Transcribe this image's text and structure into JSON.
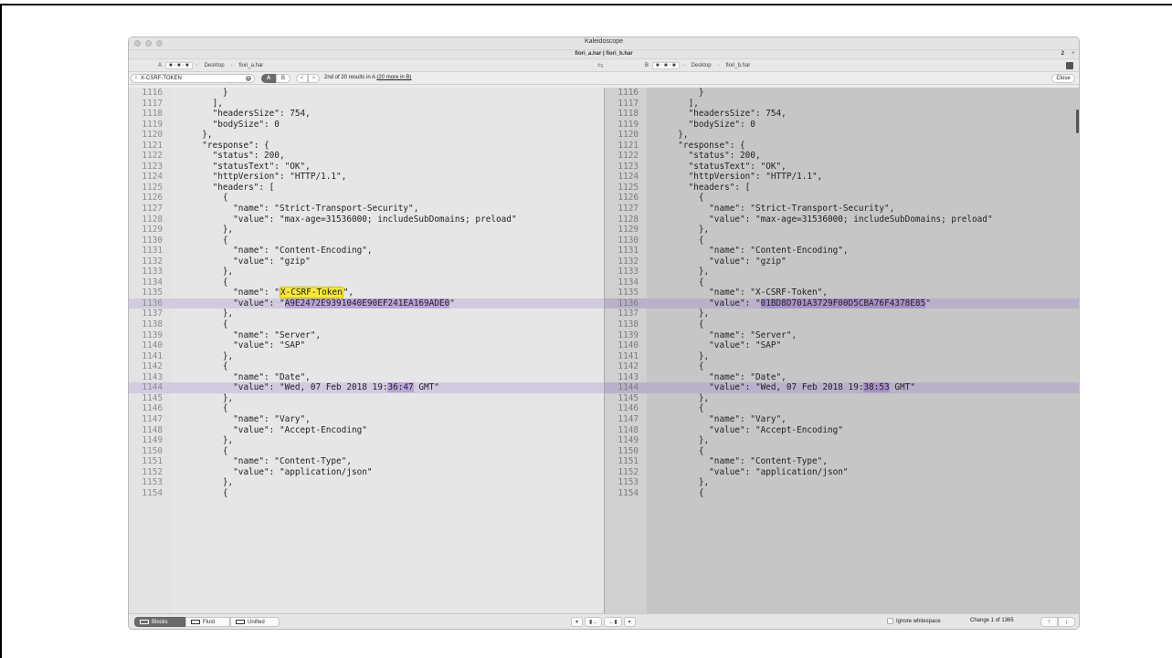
{
  "window": {
    "title": "Kaleidoscope",
    "tab_title": "fiori_a.har | fiori_b.har",
    "tab_count": "2",
    "tab_add": "+"
  },
  "paths": {
    "a": {
      "side_label": "A",
      "folder": "Desktop",
      "file": "fiori_a.har"
    },
    "b": {
      "side_label": "B",
      "folder": "Desktop",
      "file": "fiori_b.har"
    },
    "swap_glyph": "⇆"
  },
  "search": {
    "query": "X-CSRF-TOKEN",
    "seg_a": "A",
    "seg_b": "B",
    "prev": "<",
    "next": ">",
    "results_text": "2nd of 20 results in A",
    "more_text": "(20 more in B)",
    "close_label": "Close"
  },
  "pane_a_lines": [
    {
      "n": "1116",
      "t": "      }",
      "hl": false
    },
    {
      "n": "1117",
      "t": "    ],",
      "hl": false
    },
    {
      "n": "1118",
      "t": "    \"headersSize\": 754,",
      "hl": false
    },
    {
      "n": "1119",
      "t": "    \"bodySize\": 0",
      "hl": false
    },
    {
      "n": "1120",
      "t": "  },",
      "hl": false
    },
    {
      "n": "1121",
      "t": "  \"response\": {",
      "hl": false
    },
    {
      "n": "1122",
      "t": "    \"status\": 200,",
      "hl": false
    },
    {
      "n": "1123",
      "t": "    \"statusText\": \"OK\",",
      "hl": false
    },
    {
      "n": "1124",
      "t": "    \"httpVersion\": \"HTTP/1.1\",",
      "hl": false
    },
    {
      "n": "1125",
      "t": "    \"headers\": [",
      "hl": false
    },
    {
      "n": "1126",
      "t": "      {",
      "hl": false
    },
    {
      "n": "1127",
      "t": "        \"name\": \"Strict-Transport-Security\",",
      "hl": false
    },
    {
      "n": "1128",
      "t": "        \"value\": \"max-age=31536000; includeSubDomains; preload\"",
      "hl": false
    },
    {
      "n": "1129",
      "t": "      },",
      "hl": false
    },
    {
      "n": "1130",
      "t": "      {",
      "hl": false
    },
    {
      "n": "1131",
      "t": "        \"name\": \"Content-Encoding\",",
      "hl": false
    },
    {
      "n": "1132",
      "t": "        \"value\": \"gzip\"",
      "hl": false
    },
    {
      "n": "1133",
      "t": "      },",
      "hl": false
    },
    {
      "n": "1134",
      "t": "      {",
      "hl": false
    },
    {
      "n": "1135",
      "pre": "        \"name\": \"",
      "find": "X-CSRF-Token",
      "post": "\",",
      "hl": false
    },
    {
      "n": "1136",
      "pre": "        \"value\": \"",
      "diff": "A9E2472E9391040E90EF241EA169ADE0",
      "post": "\"",
      "hl": true
    },
    {
      "n": "1137",
      "t": "      },",
      "hl": false
    },
    {
      "n": "1138",
      "t": "      {",
      "hl": false
    },
    {
      "n": "1139",
      "t": "        \"name\": \"Server\",",
      "hl": false
    },
    {
      "n": "1140",
      "t": "        \"value\": \"SAP\"",
      "hl": false
    },
    {
      "n": "1141",
      "t": "      },",
      "hl": false
    },
    {
      "n": "1142",
      "t": "      {",
      "hl": false
    },
    {
      "n": "1143",
      "t": "        \"name\": \"Date\",",
      "hl": false
    },
    {
      "n": "1144",
      "pre": "        \"value\": \"Wed, 07 Feb 2018 19:",
      "diff": "36:47",
      "post": " GMT\"",
      "hl": true
    },
    {
      "n": "1145",
      "t": "      },",
      "hl": false
    },
    {
      "n": "1146",
      "t": "      {",
      "hl": false
    },
    {
      "n": "1147",
      "t": "        \"name\": \"Vary\",",
      "hl": false
    },
    {
      "n": "1148",
      "t": "        \"value\": \"Accept-Encoding\"",
      "hl": false
    },
    {
      "n": "1149",
      "t": "      },",
      "hl": false
    },
    {
      "n": "1150",
      "t": "      {",
      "hl": false
    },
    {
      "n": "1151",
      "t": "        \"name\": \"Content-Type\",",
      "hl": false
    },
    {
      "n": "1152",
      "t": "        \"value\": \"application/json\"",
      "hl": false
    },
    {
      "n": "1153",
      "t": "      },",
      "hl": false
    },
    {
      "n": "1154",
      "t": "      {",
      "hl": false
    }
  ],
  "pane_b_lines": [
    {
      "n": "1116",
      "t": "      }",
      "hl": false
    },
    {
      "n": "1117",
      "t": "    ],",
      "hl": false
    },
    {
      "n": "1118",
      "t": "    \"headersSize\": 754,",
      "hl": false
    },
    {
      "n": "1119",
      "t": "    \"bodySize\": 0",
      "hl": false
    },
    {
      "n": "1120",
      "t": "  },",
      "hl": false
    },
    {
      "n": "1121",
      "t": "  \"response\": {",
      "hl": false
    },
    {
      "n": "1122",
      "t": "    \"status\": 200,",
      "hl": false
    },
    {
      "n": "1123",
      "t": "    \"statusText\": \"OK\",",
      "hl": false
    },
    {
      "n": "1124",
      "t": "    \"httpVersion\": \"HTTP/1.1\",",
      "hl": false
    },
    {
      "n": "1125",
      "t": "    \"headers\": [",
      "hl": false
    },
    {
      "n": "1126",
      "t": "      {",
      "hl": false
    },
    {
      "n": "1127",
      "t": "        \"name\": \"Strict-Transport-Security\",",
      "hl": false
    },
    {
      "n": "1128",
      "t": "        \"value\": \"max-age=31536000; includeSubDomains; preload\"",
      "hl": false
    },
    {
      "n": "1129",
      "t": "      },",
      "hl": false
    },
    {
      "n": "1130",
      "t": "      {",
      "hl": false
    },
    {
      "n": "1131",
      "t": "        \"name\": \"Content-Encoding\",",
      "hl": false
    },
    {
      "n": "1132",
      "t": "        \"value\": \"gzip\"",
      "hl": false
    },
    {
      "n": "1133",
      "t": "      },",
      "hl": false
    },
    {
      "n": "1134",
      "t": "      {",
      "hl": false
    },
    {
      "n": "1135",
      "t": "        \"name\": \"X-CSRF-Token\",",
      "hl": false
    },
    {
      "n": "1136",
      "pre": "        \"value\": \"",
      "diff": "01BD8D701A3729F00D5CBA76F4378E85",
      "post": "\"",
      "hl": true
    },
    {
      "n": "1137",
      "t": "      },",
      "hl": false
    },
    {
      "n": "1138",
      "t": "      {",
      "hl": false
    },
    {
      "n": "1139",
      "t": "        \"name\": \"Server\",",
      "hl": false
    },
    {
      "n": "1140",
      "t": "        \"value\": \"SAP\"",
      "hl": false
    },
    {
      "n": "1141",
      "t": "      },",
      "hl": false
    },
    {
      "n": "1142",
      "t": "      {",
      "hl": false
    },
    {
      "n": "1143",
      "t": "        \"name\": \"Date\",",
      "hl": false
    },
    {
      "n": "1144",
      "pre": "        \"value\": \"Wed, 07 Feb 2018 19:",
      "diff": "38:53",
      "post": " GMT\"",
      "hl": true
    },
    {
      "n": "1145",
      "t": "      },",
      "hl": false
    },
    {
      "n": "1146",
      "t": "      {",
      "hl": false
    },
    {
      "n": "1147",
      "t": "        \"name\": \"Vary\",",
      "hl": false
    },
    {
      "n": "1148",
      "t": "        \"value\": \"Accept-Encoding\"",
      "hl": false
    },
    {
      "n": "1149",
      "t": "      },",
      "hl": false
    },
    {
      "n": "1150",
      "t": "      {",
      "hl": false
    },
    {
      "n": "1151",
      "t": "        \"name\": \"Content-Type\",",
      "hl": false
    },
    {
      "n": "1152",
      "t": "        \"value\": \"application/json\"",
      "hl": false
    },
    {
      "n": "1153",
      "t": "      },",
      "hl": false
    },
    {
      "n": "1154",
      "t": "      {",
      "hl": false
    }
  ],
  "bottom": {
    "blocks_label": "Blocks",
    "fluid_label": "Fluid",
    "unified_label": "Unified",
    "mid_down": "▾",
    "mid_copy_right": "▮→",
    "mid_copy_left": "←▮",
    "mid_down2": "▾",
    "ignore_label": "Ignore whitespace",
    "change_text": "Change 1 of 1365",
    "up_arrow": "↑",
    "down_arrow": "↓"
  },
  "colors": {
    "find_highlight": "#f5e83a",
    "diff_highlight": "#b9a4d9",
    "changed_line": "#d2cbe0"
  },
  "icons": {
    "search": "search-icon",
    "clear": "clear-search-icon",
    "swap": "swap-sides-icon",
    "folder": "folder-icon"
  }
}
